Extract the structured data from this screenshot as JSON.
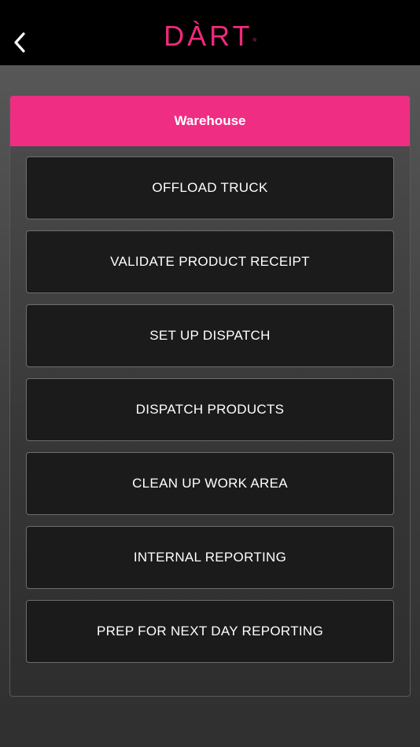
{
  "app": {
    "brand": "DÀRT",
    "trademark": "®",
    "brand_color": "#ee2a7b",
    "back_icon": "chevron-left-icon"
  },
  "section": {
    "title": "Warehouse",
    "header_color": "#ef2d83"
  },
  "menu": {
    "items": [
      {
        "label": "OFFLOAD TRUCK"
      },
      {
        "label": "VALIDATE PRODUCT RECEIPT"
      },
      {
        "label": "SET UP DISPATCH"
      },
      {
        "label": "DISPATCH PRODUCTS"
      },
      {
        "label": "CLEAN UP WORK AREA"
      },
      {
        "label": "INTERNAL REPORTING"
      },
      {
        "label": "PREP FOR NEXT DAY REPORTING"
      }
    ]
  }
}
